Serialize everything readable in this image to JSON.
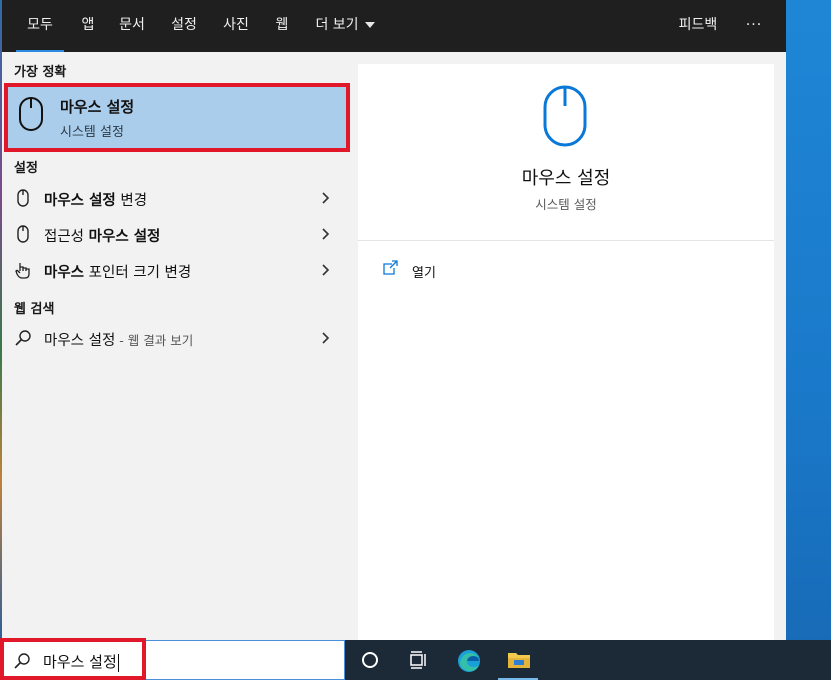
{
  "nav": {
    "tabs": [
      "모두",
      "앱",
      "문서",
      "설정",
      "사진",
      "웹",
      "더 보기"
    ],
    "active_tab": "모두",
    "feedback": "피드백",
    "more_options": "···"
  },
  "best_match": {
    "header": "가장 정확",
    "title": "마우스 설정",
    "subtitle": "시스템 설정",
    "icon": "mouse-icon"
  },
  "settings": {
    "header": "설정",
    "items": [
      {
        "bold": "마우스 설정",
        "normal_after": " 변경",
        "icon": "mouse-icon"
      },
      {
        "normal_before": "접근성 ",
        "bold": "마우스 설정",
        "icon": "mouse-icon"
      },
      {
        "bold": "마우스",
        "normal_after": " 포인터 크기 변경",
        "icon": "hand-pointer-icon"
      }
    ]
  },
  "web": {
    "header": "웹 검색",
    "item_label": "마우스 설정",
    "item_sub": " - 웹 결과 보기",
    "icon": "search-icon"
  },
  "preview": {
    "title": "마우스 설정",
    "subtitle": "시스템 설정",
    "open_label": "열기"
  },
  "search": {
    "value": "마우스 설정"
  },
  "colors": {
    "accent": "#2b8ae3",
    "highlight_border": "#e0182a",
    "selected_bg": "#aacdeb",
    "nav_bg": "#1f1f1f",
    "taskbar_bg": "#1c2a38"
  }
}
